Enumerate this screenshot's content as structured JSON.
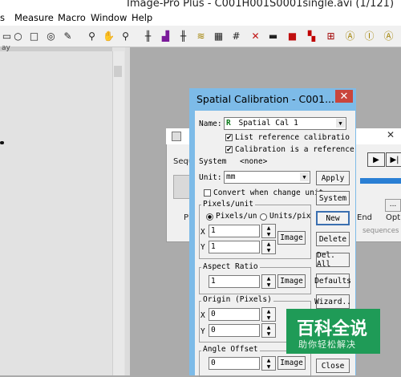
{
  "window": {
    "title": "Image-Pro Plus - C001H001S0001single.avi (1/121)"
  },
  "menu": {
    "items": [
      "Measure",
      "Macro",
      "Window",
      "Help"
    ]
  },
  "image_panel": {
    "partial_label": "ay"
  },
  "sequence_window": {
    "label_partial": "Seque",
    "play_label_partial": "Pl",
    "end_label_partial": "End",
    "options_label_partial": "Opti",
    "status_partial": "sequences",
    "dots": "..."
  },
  "calibration_dialog": {
    "title": "Spatial Calibration - C001...",
    "close": "✕",
    "name_label": "Name:",
    "name_icon": "R",
    "name_value": "Spatial Cal 1",
    "list_reference": "List reference calibratio",
    "calibration_reference": "Calibration is a reference",
    "system_label": "System",
    "system_value": "<none>",
    "unit_label": "Unit:",
    "unit_value": "mm",
    "convert_label": "Convert when change unit",
    "pixels_group": "Pixels/unit",
    "radio_pixels": "Pixels/un",
    "radio_units": "Units/pix",
    "x_label": "X",
    "y_label": "Y",
    "x_value": "1",
    "y_value": "1",
    "aspect_group": "Aspect Ratio",
    "aspect_value": "1",
    "origin_group": "Origin (Pixels)",
    "origin_x": "0",
    "origin_y": "0",
    "angle_group": "Angle Offset",
    "angle_value": "0",
    "buttons": {
      "apply": "Apply",
      "system": "System",
      "new": "New",
      "delete": "Delete",
      "del_all": "Del. All",
      "defaults": "Defaults",
      "wizard": "Wizard..",
      "close": "Close",
      "image": "Image"
    }
  },
  "watermark": {
    "logo": "百科全说",
    "sub": "助你轻松解决"
  }
}
